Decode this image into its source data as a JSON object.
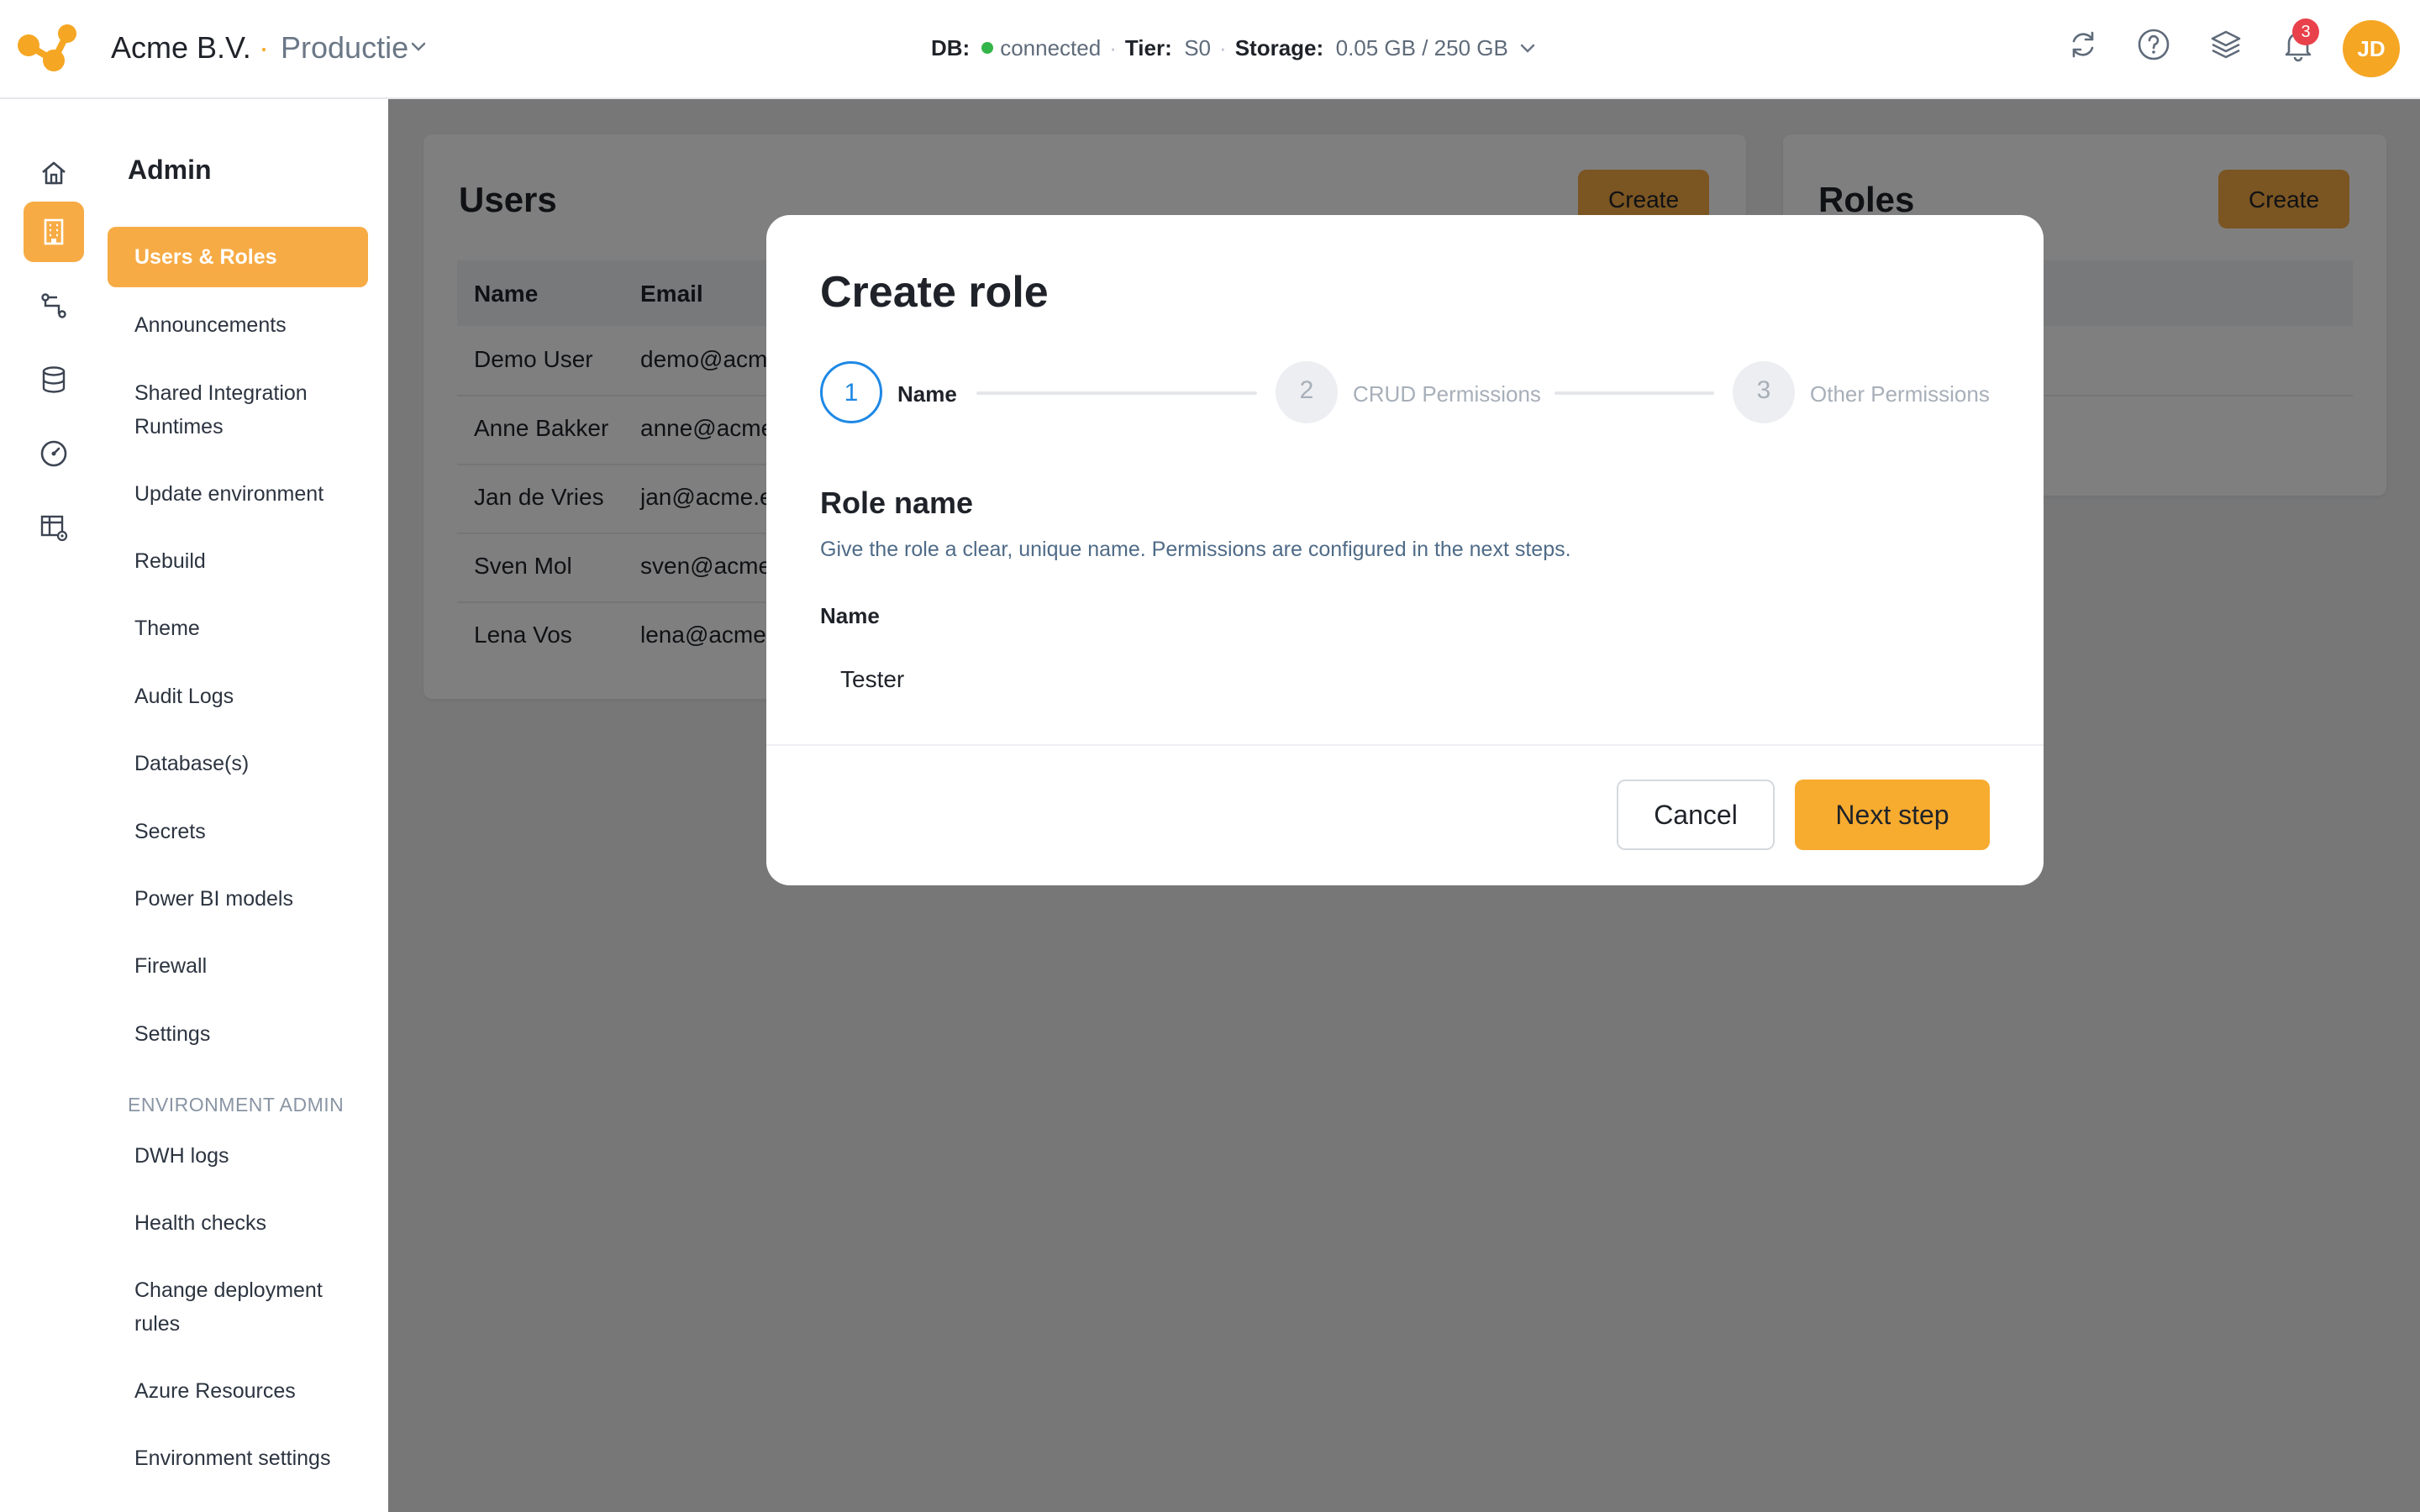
{
  "header": {
    "org_name": "Acme B.V.",
    "separator": "·",
    "environment": "Productie",
    "db_label": "DB:",
    "db_status": "connected",
    "tier_label": "Tier:",
    "tier_value": "S0",
    "storage_label": "Storage:",
    "storage_value": "0.05 GB / 250 GB",
    "notification_count": "3",
    "avatar_initials": "JD",
    "icons": [
      "refresh-icon",
      "help-icon",
      "layers-icon",
      "bell-icon"
    ]
  },
  "rail": {
    "icons": [
      "home-icon",
      "building-icon",
      "pipeline-icon",
      "database-icon",
      "gauge-icon",
      "table-settings-icon"
    ],
    "active_index": 1
  },
  "sidenav": {
    "title": "Admin",
    "items": [
      {
        "label": "Users & Roles",
        "active": true
      },
      {
        "label": "Announcements"
      },
      {
        "label": "Shared Integration Runtimes"
      },
      {
        "label": "Update environment"
      },
      {
        "label": "Rebuild"
      },
      {
        "label": "Theme"
      },
      {
        "label": "Audit Logs"
      },
      {
        "label": "Database(s)"
      },
      {
        "label": "Secrets"
      },
      {
        "label": "Power BI models"
      },
      {
        "label": "Firewall"
      },
      {
        "label": "Settings"
      }
    ],
    "section_label": "ENVIRONMENT ADMIN",
    "section_items": [
      {
        "label": "DWH logs"
      },
      {
        "label": "Health checks"
      },
      {
        "label": "Change deployment rules"
      },
      {
        "label": "Azure Resources"
      },
      {
        "label": "Environment settings"
      }
    ]
  },
  "users_card": {
    "title": "Users",
    "create_label": "Create",
    "columns": [
      "Name",
      "Email"
    ],
    "rows": [
      {
        "name": "Demo User",
        "email": "demo@acm"
      },
      {
        "name": "Anne Bakker",
        "email": "anne@acme"
      },
      {
        "name": "Jan de Vries",
        "email": "jan@acme.e"
      },
      {
        "name": "Sven Mol",
        "email": "sven@acme"
      },
      {
        "name": "Lena Vos",
        "email": "lena@acme."
      }
    ]
  },
  "roles_card": {
    "title": "Roles",
    "create_label": "Create"
  },
  "modal": {
    "title": "Create role",
    "steps": [
      {
        "number": "1",
        "label": "Name",
        "active": true
      },
      {
        "number": "2",
        "label": "CRUD Permissions",
        "active": false
      },
      {
        "number": "3",
        "label": "Other Permissions",
        "active": false
      }
    ],
    "section_title": "Role name",
    "section_description": "Give the role a clear, unique name. Permissions are configured in the next steps.",
    "field_label": "Name",
    "field_value": "Tester",
    "cancel_label": "Cancel",
    "next_label": "Next step"
  },
  "colors": {
    "accent": "#f7ab45",
    "primary_button": "#f7ab2f",
    "step_active": "#1e88e5",
    "status_green": "#34b549",
    "badge_red": "#e9414b"
  }
}
